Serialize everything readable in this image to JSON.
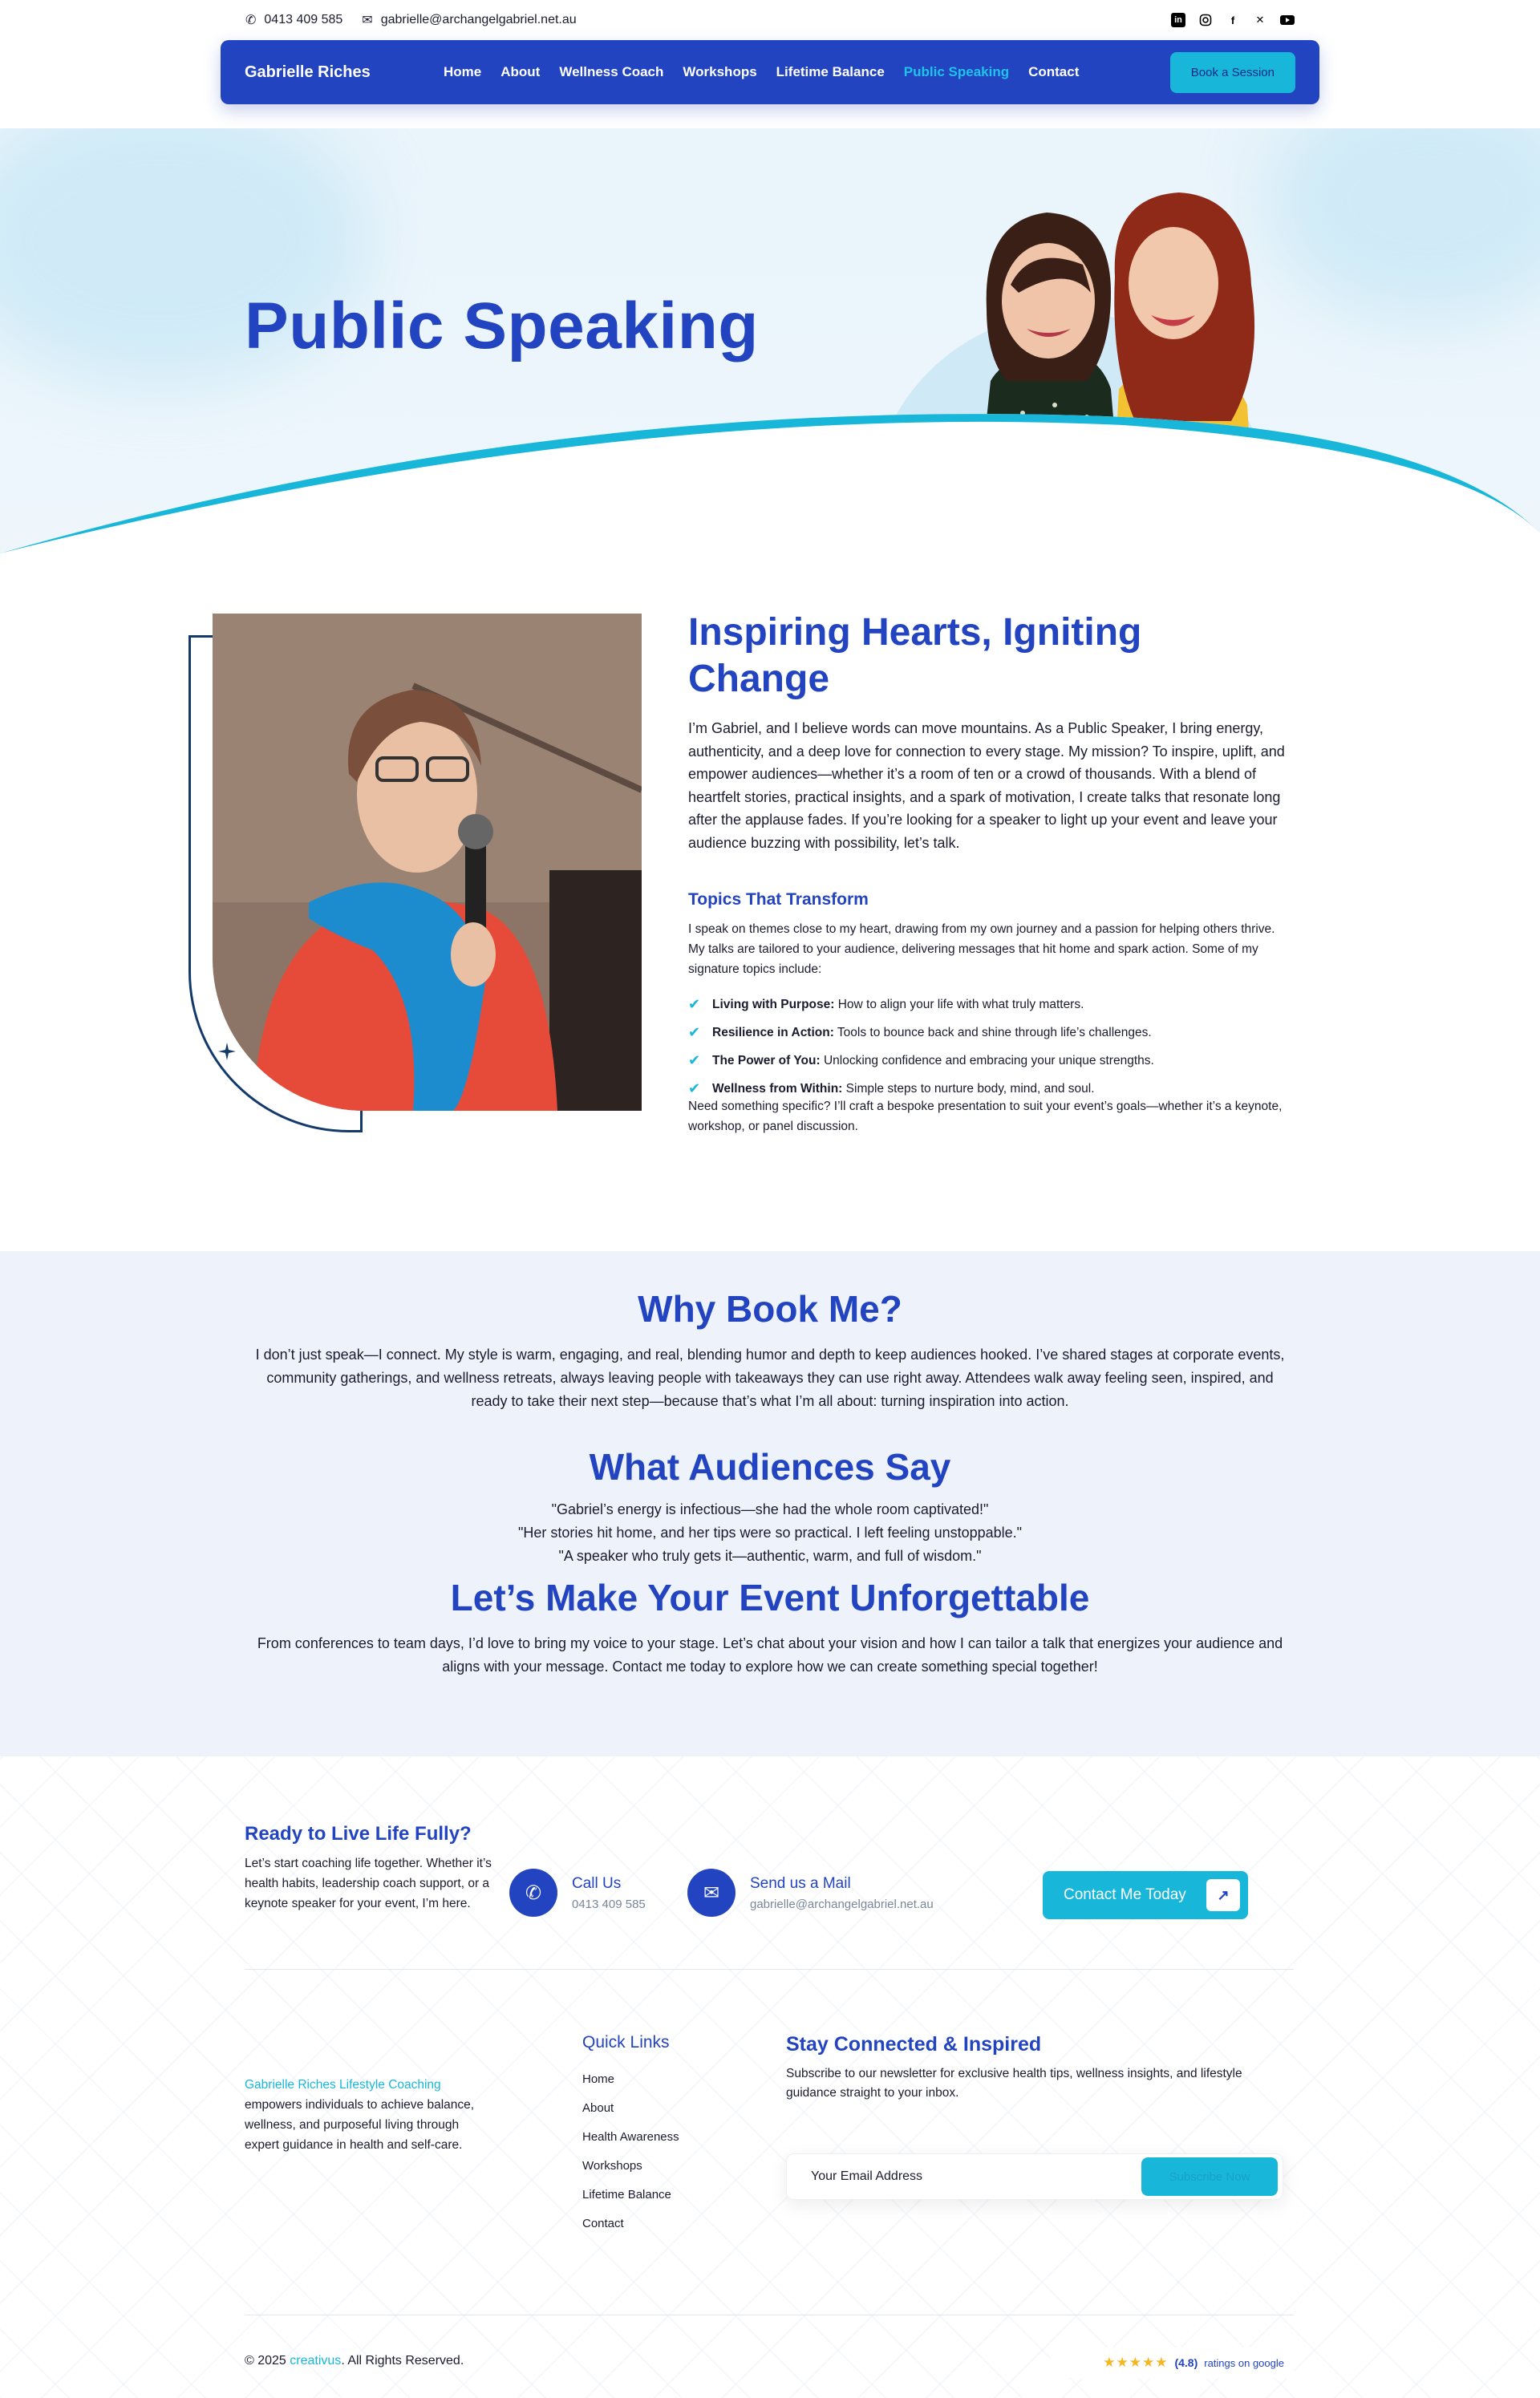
{
  "topbar": {
    "phone": "0413 409 585",
    "email": "gabrielle@archangelgabriel.net.au",
    "socials": [
      "linkedin-icon",
      "instagram-icon",
      "facebook-icon",
      "x-icon",
      "youtube-icon"
    ]
  },
  "nav": {
    "brand": "Gabrielle Riches",
    "items": [
      "Home",
      "About",
      "Wellness Coach",
      "Workshops",
      "Lifetime Balance",
      "Public Speaking",
      "Contact"
    ],
    "active": "Public Speaking",
    "cta": "Book a Session"
  },
  "hero": {
    "title": "Public Speaking"
  },
  "about": {
    "heading": "Inspiring Hearts, Igniting Change",
    "intro": "I’m Gabriel, and I believe words can move mountains. As a Public Speaker, I bring energy, authenticity, and a deep love for connection to every stage. My mission? To inspire, uplift, and empower audiences—whether it’s a room of ten or a crowd of thousands. With a blend of heartfelt stories, practical insights, and a spark of motivation, I create talks that resonate long after the applause fades. If you’re looking for a speaker to light up your event and leave your audience buzzing with possibility, let’s talk.",
    "topics_heading": "Topics That Transform",
    "topics_intro": "I speak on themes close to my heart, drawing from my own journey and a passion for helping others thrive. My talks are tailored to your audience, delivering messages that hit home and spark action. Some of my signature topics include:",
    "topics": [
      {
        "title": "Living with Purpose:",
        "text": "How to align your life with what truly matters."
      },
      {
        "title": "Resilience in Action:",
        "text": "Tools to bounce back and shine through life’s challenges."
      },
      {
        "title": "The Power of You:",
        "text": "Unlocking confidence and embracing your unique strengths."
      },
      {
        "title": "Wellness from Within:",
        "text": "Simple steps to nurture body, mind, and soul."
      }
    ],
    "outro": "Need something specific? I’ll craft a bespoke presentation to suit your event’s goals—whether it’s a keynote, workshop, or panel discussion."
  },
  "why": {
    "heading": "Why Book Me?",
    "text": "I don’t just speak—I connect. My style is warm, engaging, and real, blending humor and depth to keep audiences hooked. I’ve shared stages at corporate events, community gatherings, and wellness retreats, always leaving people with takeaways they can use right away. Attendees walk away feeling seen, inspired, and ready to take their next step—because that’s what I’m all about: turning inspiration into action.",
    "testimonials_heading": "What Audiences Say",
    "testimonials": [
      "\"Gabriel’s energy is infectious—she had the whole room captivated!\"",
      "\"Her stories hit home, and her tips were so practical. I left feeling unstoppable.\"",
      "\"A speaker who truly gets it—authentic, warm, and full of wisdom.\""
    ],
    "event_heading": "Let’s Make Your Event Unforgettable",
    "event_text": "From conferences to team days, I’d love to bring my voice to your stage. Let’s chat about your vision and how I can tailor a talk that energizes your audience and aligns with your message. Contact me today to explore how we can create something special together!"
  },
  "cta": {
    "heading": "Ready to Live Life Fully?",
    "text": "Let’s start coaching life together. Whether it’s health habits, leadership coach support, or a keynote speaker for your event, I’m here.",
    "call_label": "Call Us",
    "call_value": "0413 409 585",
    "mail_label": "Send us a Mail",
    "mail_value": "gabrielle@archangelgabriel.net.au",
    "button": "Contact Me Today"
  },
  "footer": {
    "about_highlight": "Gabrielle Riches Lifestyle Coaching",
    "about_text": "empowers individuals to achieve balance, wellness, and purposeful living through expert guidance in health and self-care.",
    "links_heading": "Quick Links",
    "links": [
      "Home",
      "About",
      "Health Awareness",
      "Workshops",
      "Lifetime Balance",
      "Contact"
    ],
    "newsletter_heading": "Stay Connected & Inspired",
    "newsletter_text": "Subscribe to our newsletter for exclusive health tips, wellness insights, and lifestyle guidance straight to your inbox.",
    "email_placeholder": "Your Email Address",
    "subscribe": "Subscribe Now",
    "copyright_pre": "© 2025",
    "copyright_brand": "creativus",
    "copyright_post": ". All Rights Reserved.",
    "rating_score": "(4.8)",
    "rating_text": "ratings on google",
    "rating_stars": 5
  },
  "colors": {
    "primary": "#2344c0",
    "accent": "#18b7da",
    "hero_bg": "#e9f4fb",
    "section_bg": "#eef3fb"
  }
}
